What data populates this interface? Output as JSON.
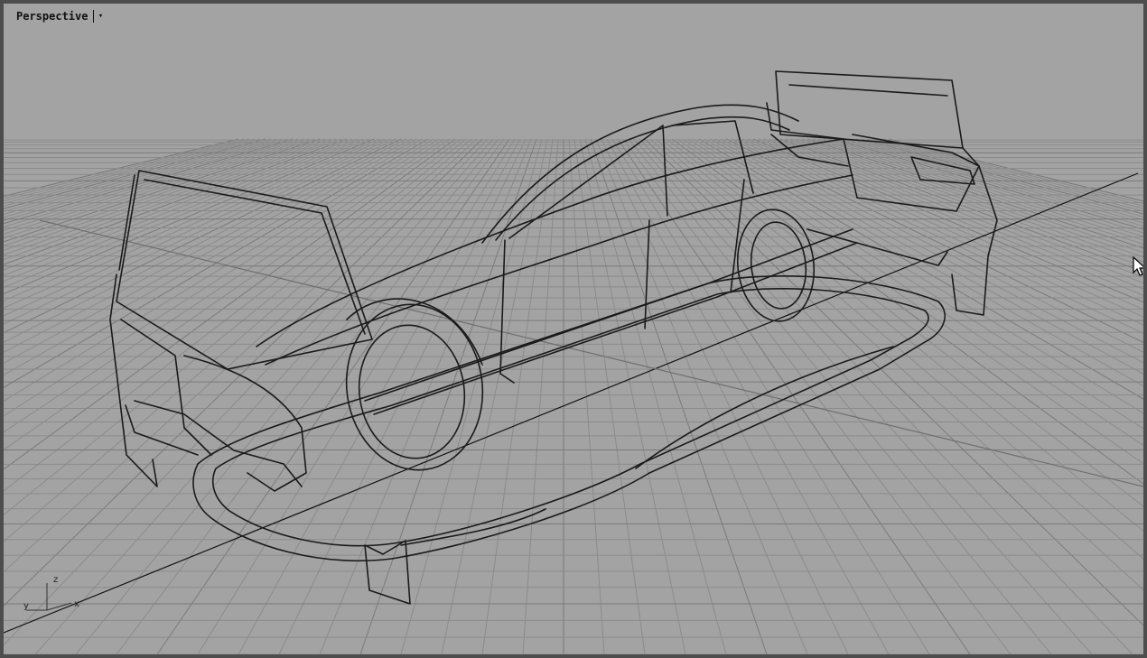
{
  "viewport": {
    "title": "Perspective",
    "menu_arrow": "▾"
  },
  "axis_widget": {
    "z": "z",
    "y": "y",
    "x": "x"
  },
  "colors": {
    "background": "#a3a3a3",
    "grid_line": "#8b8b8b",
    "grid_major": "#7a7a7a",
    "wireframe": "#1a1a1a",
    "frame": "#4d4d4d"
  },
  "icons": {
    "cursor": "mouse-pointer-icon",
    "viewport_menu": "chevron-down-icon",
    "axis": "world-axes-icon"
  }
}
